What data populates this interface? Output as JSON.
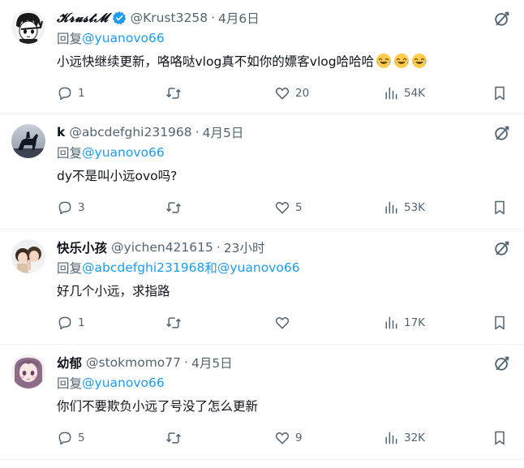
{
  "reply_prefix": "回复",
  "replies": [
    {
      "name": "𝓚𝓻𝓾𝓼𝓽𝓜",
      "handle": "@Krust3258",
      "time": "4月6日",
      "verified": true,
      "reply_to": "@yuanovo66",
      "reply_to_and": "",
      "reply_to_second": "",
      "text": "小远快继续更新，咯咯哒vlog真不如你的嫖客vlog哈哈哈",
      "emoji": [
        "laughing-tears",
        "laughing-tears",
        "laughing-tears"
      ],
      "replies": "1",
      "retweets": "",
      "likes": "20",
      "views": "54K"
    },
    {
      "name": "k",
      "handle": "@abcdefghi231968",
      "time": "4月5日",
      "verified": false,
      "reply_to": "@yuanovo66",
      "reply_to_and": "",
      "reply_to_second": "",
      "text": "dy不是叫小远ovo吗?",
      "emoji": [],
      "replies": "3",
      "retweets": "",
      "likes": "5",
      "views": "53K"
    },
    {
      "name": "快乐小孩",
      "handle": "@yichen421615",
      "time": "23小时",
      "verified": false,
      "reply_to": "@abcdefghi231968",
      "reply_to_and": " 和 ",
      "reply_to_second": "@yuanovo66",
      "text": "好几个小远，求指路",
      "emoji": [],
      "replies": "1",
      "retweets": "",
      "likes": "",
      "views": "17K"
    },
    {
      "name": "幼郁",
      "handle": "@stokmomo77",
      "time": "4月5日",
      "verified": false,
      "reply_to": "@yuanovo66",
      "reply_to_and": "",
      "reply_to_second": "",
      "text": "你们不要欺负小远了号没了怎么更新",
      "emoji": [],
      "replies": "5",
      "retweets": "",
      "likes": "9",
      "views": "32K"
    }
  ],
  "colors": {
    "text": "#0f1419",
    "secondary": "#536471",
    "mention": "#1d9bf0",
    "verified": "#1d9bf0",
    "divider": "#eff3f4"
  },
  "icons": [
    "reply-icon",
    "retweet-icon",
    "like-icon",
    "views-icon",
    "bookmark-icon",
    "grok-icon",
    "verified-icon"
  ]
}
